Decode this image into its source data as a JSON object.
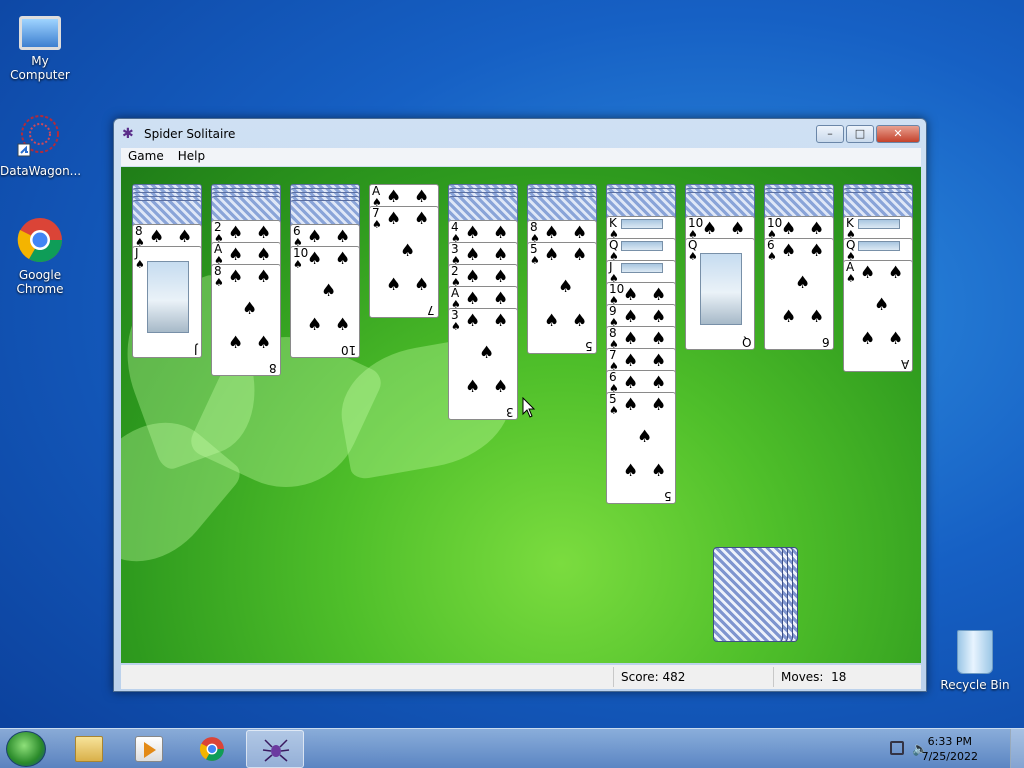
{
  "desktop": {
    "icons": [
      {
        "label": "My Computer"
      },
      {
        "label": "DataWagon..."
      },
      {
        "label": "Google\nChrome"
      },
      {
        "label": "Recycle Bin"
      }
    ]
  },
  "window": {
    "title": "Spider Solitaire",
    "menu": [
      "Game",
      "Help"
    ],
    "controls": {
      "minimize": "–",
      "maximize": "□",
      "close": "✕"
    }
  },
  "status": {
    "score_label": "Score:",
    "score_value": "482",
    "moves_label": "Moves:",
    "moves_value": "18"
  },
  "columns": [
    {
      "backs": 5,
      "faces": [
        {
          "rank": "8"
        },
        {
          "rank": "J",
          "face": true
        }
      ]
    },
    {
      "backs": 4,
      "faces": [
        {
          "rank": "2"
        },
        {
          "rank": "A"
        },
        {
          "rank": "8"
        }
      ]
    },
    {
      "backs": 5,
      "faces": [
        {
          "rank": "6"
        },
        {
          "rank": "10"
        }
      ]
    },
    {
      "backs": 0,
      "faces": [
        {
          "rank": "A"
        },
        {
          "rank": "7"
        }
      ]
    },
    {
      "backs": 4,
      "faces": [
        {
          "rank": "4"
        },
        {
          "rank": "3"
        },
        {
          "rank": "2"
        },
        {
          "rank": "A"
        },
        {
          "rank": "3"
        }
      ]
    },
    {
      "backs": 4,
      "faces": [
        {
          "rank": "8"
        },
        {
          "rank": "5"
        }
      ]
    },
    {
      "backs": 3,
      "faces": [
        {
          "rank": "K",
          "face": true
        },
        {
          "rank": "Q",
          "face": true
        },
        {
          "rank": "J",
          "face": true
        },
        {
          "rank": "10"
        },
        {
          "rank": "9"
        },
        {
          "rank": "8"
        },
        {
          "rank": "7"
        },
        {
          "rank": "6"
        },
        {
          "rank": "5"
        }
      ]
    },
    {
      "backs": 3,
      "faces": [
        {
          "rank": "10"
        },
        {
          "rank": "Q",
          "face": true
        }
      ]
    },
    {
      "backs": 3,
      "faces": [
        {
          "rank": "10"
        },
        {
          "rank": "6"
        }
      ]
    },
    {
      "backs": 3,
      "faces": [
        {
          "rank": "K",
          "face": true
        },
        {
          "rank": "Q",
          "face": true
        },
        {
          "rank": "A"
        }
      ]
    }
  ],
  "suit_symbol": "♠",
  "stock_piles": 4,
  "taskbar": {
    "time": "6:33 PM",
    "date": "7/25/2022"
  }
}
